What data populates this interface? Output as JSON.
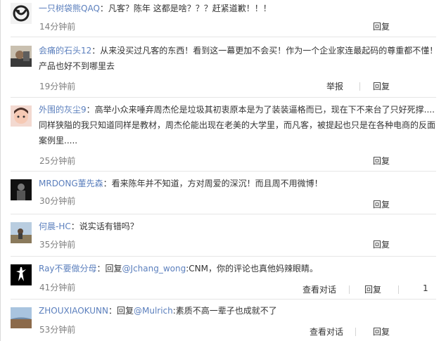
{
  "comments": [
    {
      "username": "一只树袋熊QAQ",
      "text": "：凡客？陈年 这都是啥？？？赶紧道歉！！！",
      "time": "14分钟前",
      "reply": "回复"
    },
    {
      "username": "会痛的石头12",
      "text": "：从来没买过凡客的东西！看到这一幕更加不会买！作为一个企业家连最起码的尊重都不懂！产品也好不到哪里去",
      "time": "19分钟前",
      "report": "举报",
      "reply": "回复"
    },
    {
      "username": "外围的灰尘9",
      "text": "：高举小众来唾弃周杰伦是垃圾其初衷原本是为了装装逼格而已，现在下不来台了只好死撑....同样狭隘的我只知道同样是教材，周杰伦能出现在老美的大学里，而凡客，被提起也只是在各种电商的反面案例里.....",
      "time": "25分钟前",
      "reply": "回复"
    },
    {
      "username": "MRDONG董先森",
      "text": "：看来陈年并不知道，方对周爱的深沉！而且周不用微博！",
      "time": "30分钟前",
      "reply": "回复"
    },
    {
      "username": "何晨-HC",
      "text": "：说实话有错吗？",
      "time": "35分钟前",
      "reply": "回复"
    },
    {
      "username": "Ray不要做分母",
      "text_prefix": "：回复",
      "mention": "@Jchang_wong",
      "text": ":CNM，你的评论也真他妈辣眼睛。",
      "time": "41分钟前",
      "view_convo": "查看对话",
      "reply": "回复",
      "like_count": "1"
    },
    {
      "username": "ZHOUXIAOKUNN",
      "text_prefix": "：回复",
      "mention": "@Mulrich",
      "text": ":素质不高一辈子也成就不了",
      "time": "53分钟前",
      "view_convo": "查看对话",
      "reply": "回复"
    }
  ],
  "colors": {
    "username": "#5b7fbd",
    "text": "#333333",
    "time": "#808080"
  }
}
